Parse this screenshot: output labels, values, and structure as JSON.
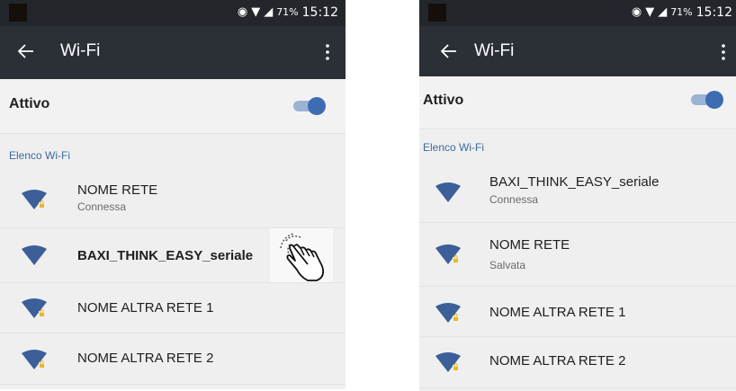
{
  "screens": [
    {
      "status": {
        "battery": "71%",
        "time": "15:12"
      },
      "appbar": {
        "title": "Wi-Fi"
      },
      "toggle": {
        "label": "Attivo",
        "on": true
      },
      "section_label": "Elenco Wi-Fi",
      "networks": [
        {
          "name": "NOME RETE",
          "status": "Connessa",
          "secured": true
        },
        {
          "name": "BAXI_THINK_EASY_seriale",
          "status": "",
          "secured": false
        },
        {
          "name": "NOME ALTRA RETE 1",
          "status": "",
          "secured": true
        },
        {
          "name": "NOME ALTRA RETE 2",
          "status": "",
          "secured": true
        }
      ],
      "tap_hint_icon": "hand-tap-icon"
    },
    {
      "status": {
        "battery": "71%",
        "time": "15:12"
      },
      "appbar": {
        "title": "Wi-Fi"
      },
      "toggle": {
        "label": "Attivo",
        "on": true
      },
      "section_label": "Elenco Wi-Fi",
      "networks": [
        {
          "name": "BAXI_THINK_EASY_seriale",
          "status": "Connessa",
          "secured": false
        },
        {
          "name": "NOME RETE",
          "status": "Salvata",
          "secured": true
        },
        {
          "name": "NOME ALTRA RETE 1",
          "status": "",
          "secured": true
        },
        {
          "name": "NOME ALTRA RETE 2",
          "status": "",
          "secured": true
        }
      ]
    }
  ],
  "colors": {
    "statusbar": "#23272c",
    "appbar": "#2b3036",
    "accent": "#3d6cb3",
    "wifi": "#3c5f99",
    "section_label": "#3d6a9c"
  }
}
